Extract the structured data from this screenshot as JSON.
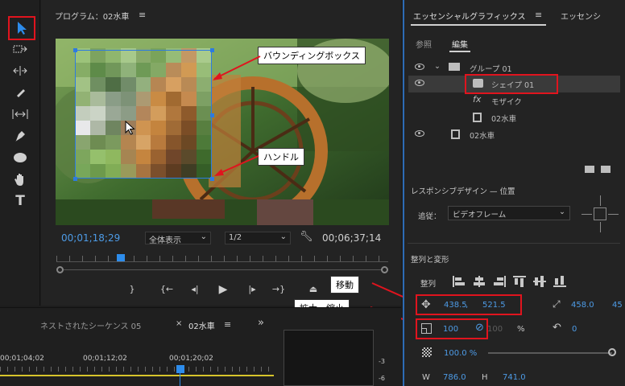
{
  "program": {
    "title": "プログラム：02水車",
    "timecode": "00;01;18;29",
    "fit": "全体表示",
    "resolution": "1/2",
    "duration": "00;06;37;14"
  },
  "timeline": {
    "tab_nested": "ネストされたシーケンス 05",
    "tab_close": "×",
    "tab_active": "02水車",
    "times": [
      "00;01;04;02",
      "00;01;12;02",
      "00;01;20;02"
    ],
    "meter_vals": [
      "-3",
      "-6"
    ]
  },
  "egp": {
    "title": "エッセンシャルグラフィックス",
    "title2": "エッセンシ",
    "subtab_browse": "参照",
    "subtab_edit": "編集",
    "layers": [
      {
        "label": "グループ 01"
      },
      {
        "label": "シェイプ 01"
      },
      {
        "label": "モザイク"
      },
      {
        "label": "02水車"
      },
      {
        "label": "02水車"
      }
    ],
    "responsive_label": "レスポンシブデザイン — 位置",
    "follow_label": "追従：",
    "follow_value": "ビデオフレーム",
    "align_section": "整列と変形",
    "align_label": "整列",
    "pos_x": "438.5",
    "pos_sep": ",",
    "pos_y": "521.5",
    "anchor_x": "458.0",
    "anchor_y_partial": "45",
    "scale": "100",
    "scale2": "100",
    "scale_unit": "%",
    "rotation": "0",
    "opacity": "100.0 %",
    "w_label": "W",
    "w_value": "786.0",
    "h_label": "H",
    "h_value": "741.0"
  },
  "callouts": {
    "bounding_box": "バウンディングボックス",
    "handle": "ハンドル",
    "move": "移動",
    "scale": "拡大・縮小"
  },
  "colors": {
    "accent": "#4d9be6",
    "highlight_red": "#e0141e",
    "panel_bg": "#232323"
  }
}
